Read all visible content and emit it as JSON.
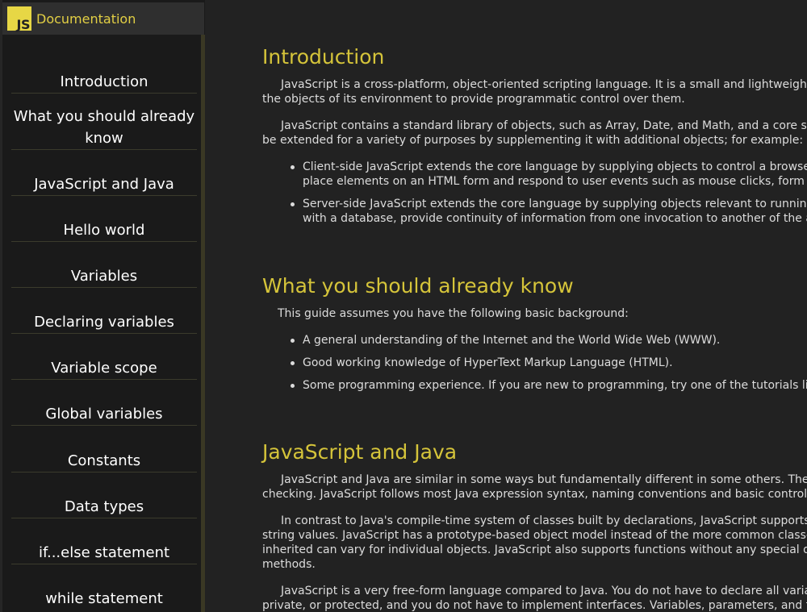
{
  "header": {
    "logo_text": "JS",
    "title": "Documentation"
  },
  "sidebar": {
    "items": [
      {
        "label": "Introduction"
      },
      {
        "label": "What you should already know"
      },
      {
        "label": "JavaScript and Java"
      },
      {
        "label": "Hello world"
      },
      {
        "label": "Variables"
      },
      {
        "label": "Declaring variables"
      },
      {
        "label": "Variable scope"
      },
      {
        "label": "Global variables"
      },
      {
        "label": "Constants"
      },
      {
        "label": "Data types"
      },
      {
        "label": "if...else statement"
      },
      {
        "label": "while statement"
      }
    ]
  },
  "main": {
    "intro": {
      "heading": "Introduction",
      "p1_l1": "JavaScript is a cross-platform, object-oriented scripting language. It is a small and lightweight langua",
      "p1_l2": "the objects of its environment to provide programmatic control over them.",
      "p2_l1": "JavaScript contains a standard library of objects, such as Array, Date, and Math, and a core set of lan",
      "p2_l2": "be extended for a variety of purposes by supplementing it with additional objects; for example:",
      "b1_l1": "Client-side JavaScript extends the core language by supplying objects to control a browser and i",
      "b1_l2": "place elements on an HTML form and respond to user events such as mouse clicks, form input,",
      "b2_l1": "Server-side JavaScript extends the core language by supplying objects relevant to running JavaS",
      "b2_l2": "with a database, provide continuity of information from one invocation to another of the applicat"
    },
    "know": {
      "heading": "What you should already know",
      "p1": "This guide assumes you have the following basic background:",
      "b1": "A general understanding of the Internet and the World Wide Web (WWW).",
      "b2": "Good working knowledge of HyperText Markup Language (HTML).",
      "b3": "Some programming experience. If you are new to programming, try one of the tutorials linked on"
    },
    "java": {
      "heading": "JavaScript and Java",
      "p1_l1": "JavaScript and Java are similar in some ways but fundamentally different in some others. The JavaS",
      "p1_l2": "checking. JavaScript follows most Java expression syntax, naming conventions and basic control-flow c",
      "p2_l1": "In contrast to Java's compile-time system of classes built by declarations, JavaScript supports a run",
      "p2_l2": "string values. JavaScript has a prototype-based object model instead of the more common class-based",
      "p2_l3": "inherited can vary for individual objects. JavaScript also supports functions without any special declarat",
      "p2_l4": "methods.",
      "p3_l1": "JavaScript is a very free-form language compared to Java. You do not have to declare all variables, c",
      "p3_l2": "private, or protected, and you do not have to implement interfaces. Variables, parameters, and function r"
    }
  }
}
